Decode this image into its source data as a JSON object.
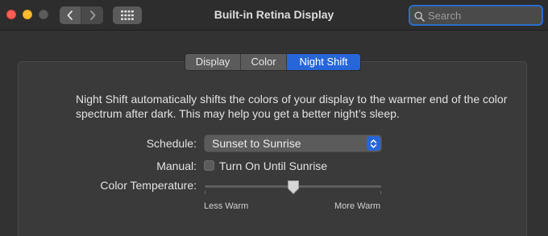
{
  "window": {
    "title": "Built-in Retina Display"
  },
  "toolbar": {
    "back_icon": "chevron-left-icon",
    "forward_icon": "chevron-right-icon",
    "grid_icon": "grid-icon"
  },
  "search": {
    "placeholder": "Search",
    "value": ""
  },
  "tabs": [
    {
      "label": "Display",
      "selected": false
    },
    {
      "label": "Color",
      "selected": false
    },
    {
      "label": "Night Shift",
      "selected": true
    }
  ],
  "night_shift": {
    "description": "Night Shift automatically shifts the colors of your display to the warmer end of the color spectrum after dark. This may help you get a better night’s sleep.",
    "schedule": {
      "label": "Schedule:",
      "value": "Sunset to Sunrise"
    },
    "manual": {
      "label": "Manual:",
      "checkbox_label": "Turn On Until Sunrise",
      "checked": false
    },
    "color_temperature": {
      "label": "Color Temperature:",
      "min_label": "Less Warm",
      "max_label": "More Warm",
      "value": 0.5
    }
  },
  "colors": {
    "accent": "#2766d8",
    "close": "#fe5f57",
    "minimize": "#febc2e",
    "search_focus": "#2a6fc9"
  }
}
